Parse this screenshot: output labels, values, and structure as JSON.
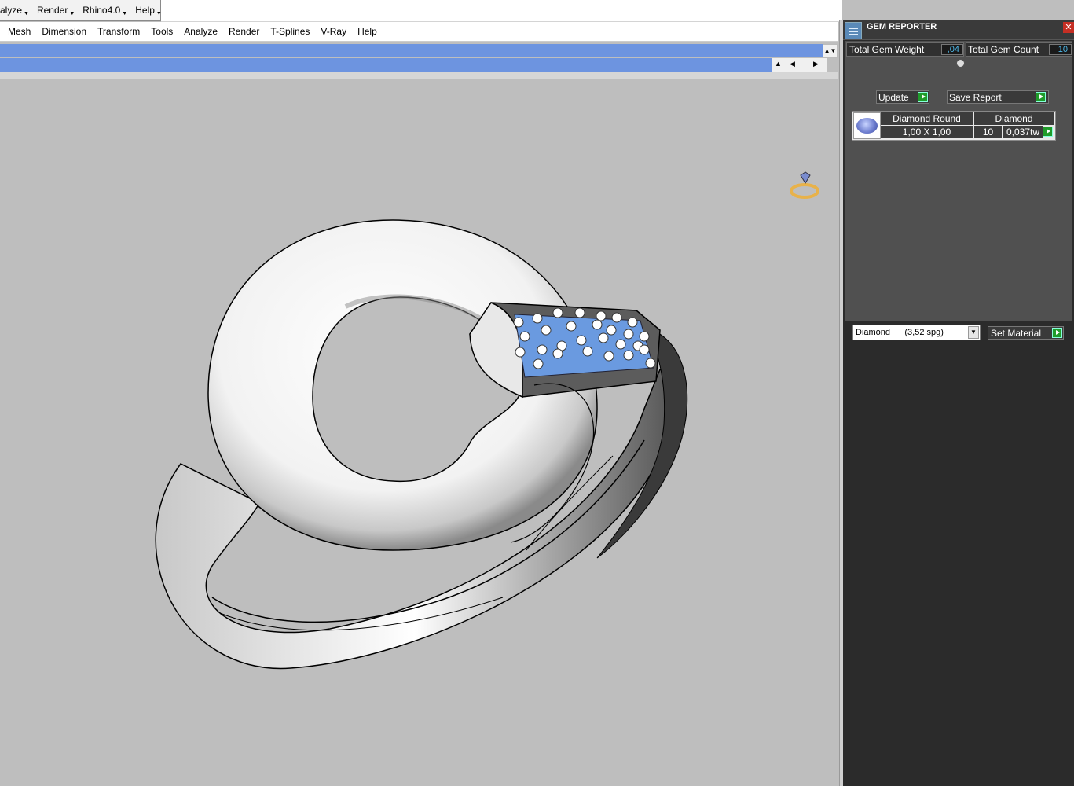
{
  "top_menu": {
    "items": [
      "alyze",
      "Render",
      "Rhino4.0",
      "Help"
    ]
  },
  "menubar": {
    "items": [
      "Mesh",
      "Dimension",
      "Transform",
      "Tools",
      "Analyze",
      "Render",
      "T-Splines",
      "V-Ray",
      "Help"
    ]
  },
  "gem_reporter": {
    "title": "GEM REPORTER",
    "total_weight_label": "Total Gem Weight",
    "total_weight_value": ",04",
    "total_count_label": "Total Gem Count",
    "total_count_value": "10",
    "update_label": "Update",
    "save_report_label": "Save Report",
    "table": {
      "col1_header": "Diamond Round",
      "col2_header": "Diamond",
      "size": "1,00 X 1,00",
      "count": "10",
      "weight": "0,037tw"
    },
    "material_select": "Diamond      (3,52 spg)",
    "set_material_label": "Set Material"
  },
  "colors": {
    "toolbar_blue": "#6d94e0",
    "viewport_bg": "#bebebe",
    "panel_bg": "#2b2b2b",
    "accent_green": "#1f9b2a",
    "value_cyan": "#4db8e8"
  }
}
